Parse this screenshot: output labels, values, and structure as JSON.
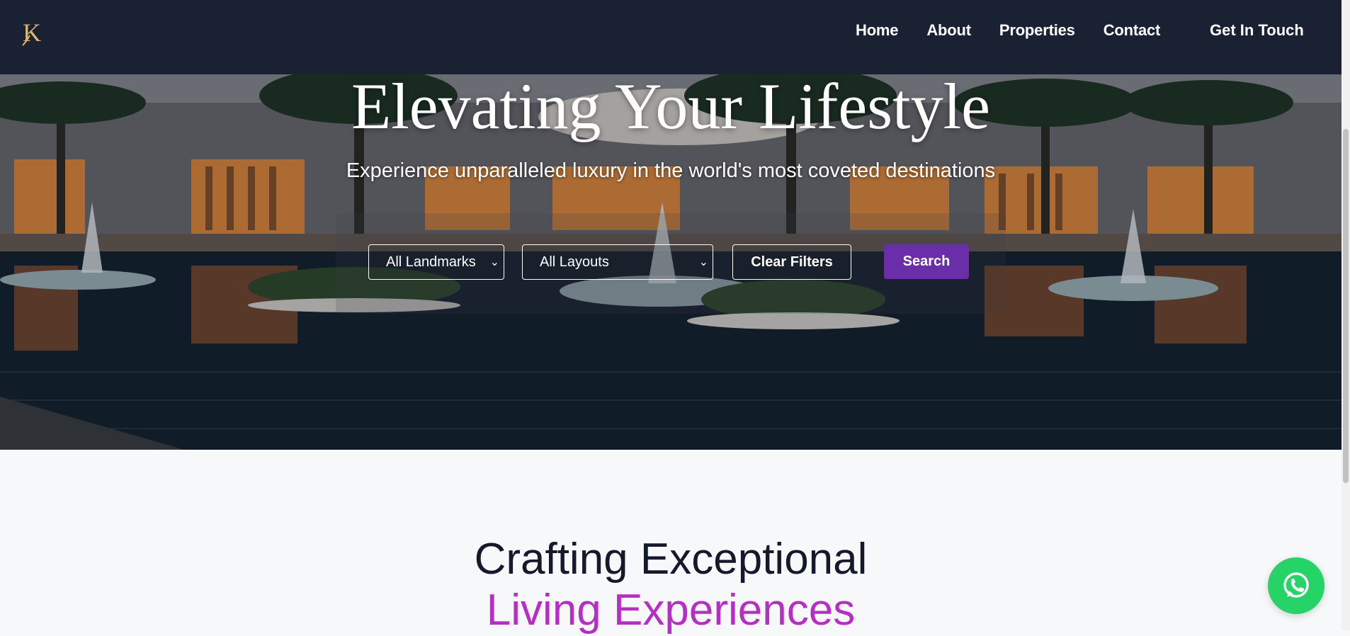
{
  "brand": {
    "logo_text": "K",
    "logo_color": "#d9b56a"
  },
  "nav": {
    "links": [
      "Home",
      "About",
      "Properties",
      "Contact"
    ],
    "cta": "Get In Touch"
  },
  "hero": {
    "title": "Elevating Your Lifestyle",
    "subtitle": "Experience unparalleled luxury in the world's most coveted destinations",
    "filters": {
      "landmark_selected": "All Landmarks",
      "layout_selected": "All Layouts",
      "clear_label": "Clear Filters",
      "search_label": "Search"
    }
  },
  "section": {
    "title_line1": "Crafting Exceptional",
    "title_line2": "Living Experiences"
  },
  "colors": {
    "navbar": "#1a2133",
    "search_button": "#6a2fa8",
    "accent": "#b62fc4",
    "whatsapp": "#25d366"
  },
  "icons": [
    "chevron-down-icon",
    "whatsapp-icon"
  ]
}
